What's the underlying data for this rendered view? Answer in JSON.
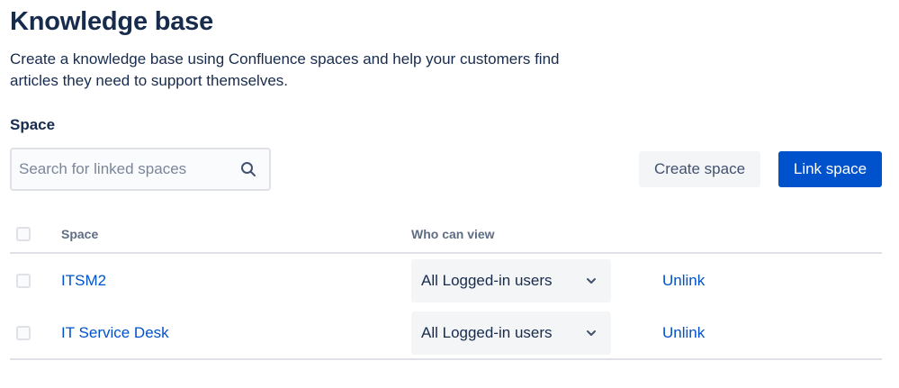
{
  "page": {
    "title": "Knowledge base",
    "description": "Create a knowledge base using Confluence spaces and help your customers find articles they need to support themselves."
  },
  "space_section": {
    "label": "Space",
    "search": {
      "placeholder": "Search for linked spaces",
      "value": ""
    },
    "create_button": "Create space",
    "link_button": "Link space"
  },
  "table": {
    "headers": {
      "space": "Space",
      "who_can_view": "Who can view"
    },
    "rows": [
      {
        "space": "ITSM2",
        "who_can_view": "All Logged-in users",
        "action": "Unlink"
      },
      {
        "space": "IT Service Desk",
        "who_can_view": "All Logged-in users",
        "action": "Unlink"
      }
    ]
  },
  "icons": {
    "search": "search-icon",
    "dropdown": "chevron-down-icon"
  },
  "colors": {
    "primary": "#0052cc",
    "text": "#172b4d",
    "subtle_text": "#5e6c84",
    "border": "#dfe1e6"
  }
}
